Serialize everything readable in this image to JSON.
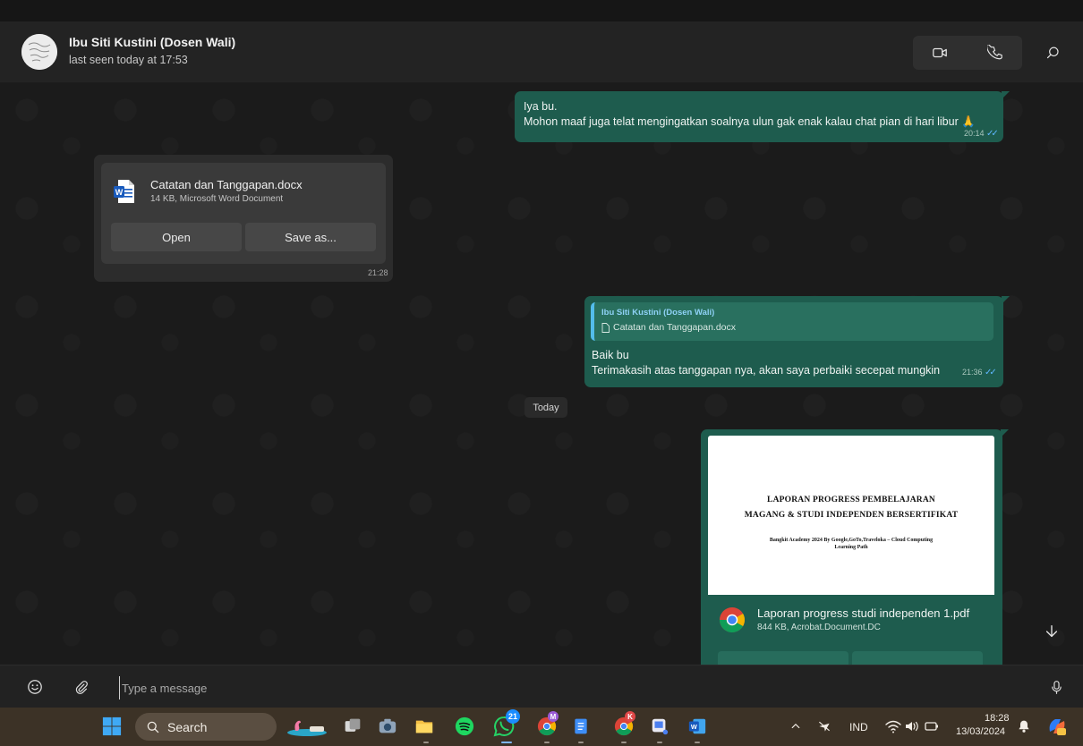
{
  "header": {
    "contact_name": "Ibu Siti Kustini (Dosen Wali)",
    "status": "last seen today at 17:53",
    "icons": [
      "video-call-icon",
      "voice-call-icon",
      "search-icon"
    ]
  },
  "messages": {
    "m1": {
      "line1": "Iya bu.",
      "line2": "Mohon maaf juga telat mengingatkan soalnya ulun gak enak kalau chat pian di hari libur",
      "emoji": "🙏",
      "time": "20:14"
    },
    "m2": {
      "file_name": "Catatan dan Tanggapan.docx",
      "file_meta": "14 KB, Microsoft Word Document",
      "open_label": "Open",
      "save_label": "Save as...",
      "time": "21:28"
    },
    "m3": {
      "quote_author": "Ibu Siti Kustini (Dosen Wali)",
      "quote_file": "Catatan dan Tanggapan.docx",
      "line1": "Baik bu",
      "line2": "Terimakasih atas tanggapan nya, akan saya perbaiki secepat mungkin",
      "time": "21:36"
    },
    "day_separator": "Today",
    "m4": {
      "preview_line1": "LAPORAN PROGRESS PEMBELAJARAN",
      "preview_line2": "MAGANG & STUDI INDEPENDEN BERSERTIFIKAT",
      "preview_line3": "Bangkit Academy 2024 By Google,GoTo,Traveloka – Cloud Computing Learning Path",
      "file_name": "Laporan progress studi independen 1.pdf",
      "file_meta": "844 KB, Acrobat.Document.DC"
    }
  },
  "composer": {
    "placeholder": "Type a message"
  },
  "taskbar": {
    "search_label": "Search",
    "whatsapp_badge": "21",
    "browser_badge_1": "M",
    "browser_badge_2": "K",
    "language": "IND",
    "time": "18:28",
    "date": "13/03/2024"
  },
  "colors": {
    "outgoing_bubble": "#1e5c4e",
    "incoming_bubble": "#2c2c2c",
    "read_ticks": "#5fb7ff",
    "taskbar": "#3c3226"
  }
}
